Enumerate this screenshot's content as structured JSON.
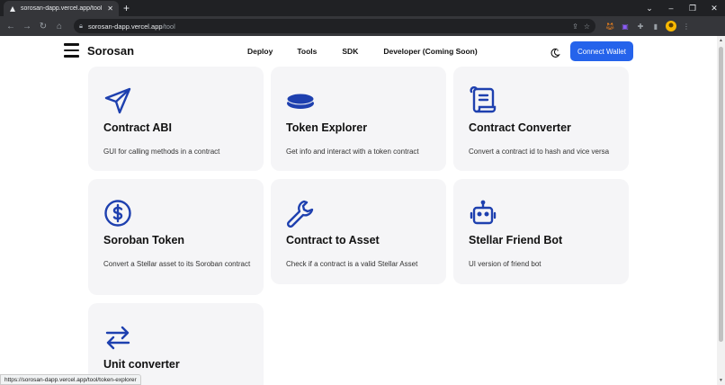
{
  "browser": {
    "tab_title": "sorosan-dapp.vercel.app/tool",
    "url_host": "sorosan-dapp.vercel.app",
    "url_path": "/tool",
    "status_url": "https://sorosan-dapp.vercel.app/tool/token-explorer"
  },
  "nav": {
    "brand": "Sorosan",
    "links": [
      "Deploy",
      "Tools",
      "SDK",
      "Developer (Coming Soon)"
    ],
    "connect_label": "Connect Wallet"
  },
  "cards": [
    {
      "title": "Contract ABI",
      "desc": "GUI for calling methods in a contract",
      "icon": "send-icon"
    },
    {
      "title": "Token Explorer",
      "desc": "Get info and interact with a token contract",
      "icon": "coin-stack-icon"
    },
    {
      "title": "Contract Converter",
      "desc": "Convert a contract id to hash and vice versa",
      "icon": "scroll-icon"
    },
    {
      "title": "Soroban Token",
      "desc": "Convert a Stellar asset to its Soroban contract",
      "icon": "dollar-circle-icon"
    },
    {
      "title": "Contract to Asset",
      "desc": "Check if a contract is a valid Stellar Asset",
      "icon": "wrench-icon"
    },
    {
      "title": "Stellar Friend Bot",
      "desc": "UI version of friend bot",
      "icon": "robot-icon"
    },
    {
      "title": "Unit converter",
      "desc": "",
      "icon": "arrows-exchange-icon"
    }
  ],
  "colors": {
    "accent": "#2563eb",
    "icon": "#1e40af",
    "card_bg": "#f5f5f7"
  }
}
